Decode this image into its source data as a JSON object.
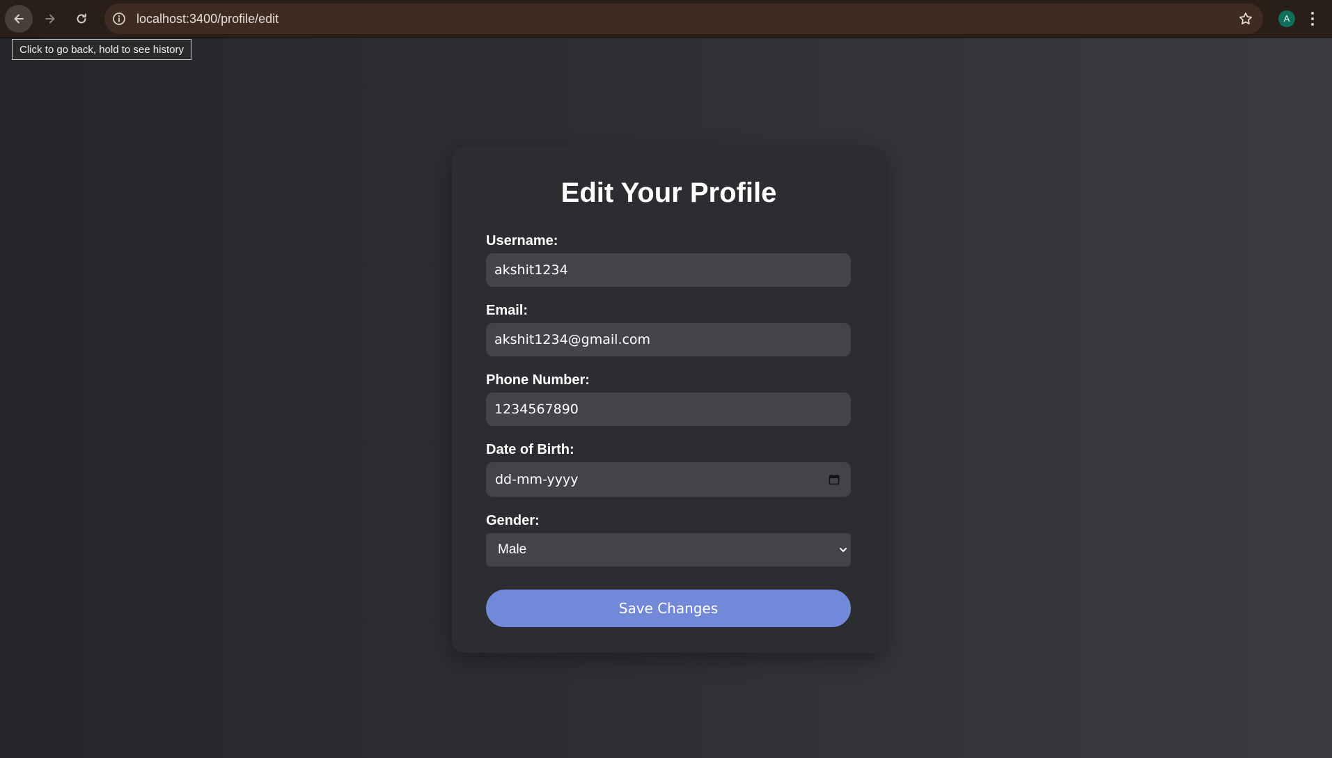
{
  "browser": {
    "url": "localhost:3400/profile/edit",
    "tooltip": "Click to go back, hold to see history",
    "avatar_initial": "A",
    "icons": {
      "back": "arrow-left-icon",
      "forward": "arrow-right-icon",
      "reload": "reload-icon",
      "site_info": "info-icon",
      "bookmark": "star-icon",
      "menu": "kebab-menu-icon"
    }
  },
  "form": {
    "title": "Edit Your Profile",
    "fields": {
      "username": {
        "label": "Username:",
        "value": "akshit1234"
      },
      "email": {
        "label": "Email:",
        "value": "akshit1234@gmail.com"
      },
      "phone": {
        "label": "Phone Number:",
        "value": "1234567890"
      },
      "dob": {
        "label": "Date of Birth:",
        "placeholder": "dd-mm-yyyy"
      },
      "gender": {
        "label": "Gender:",
        "selected": "Male"
      }
    },
    "submit_label": "Save Changes"
  },
  "colors": {
    "accent": "#7289da",
    "card": "#2b2d31",
    "input": "#42444a",
    "avatar": "#0f6f5c",
    "toolbar": "#2a1e19"
  }
}
